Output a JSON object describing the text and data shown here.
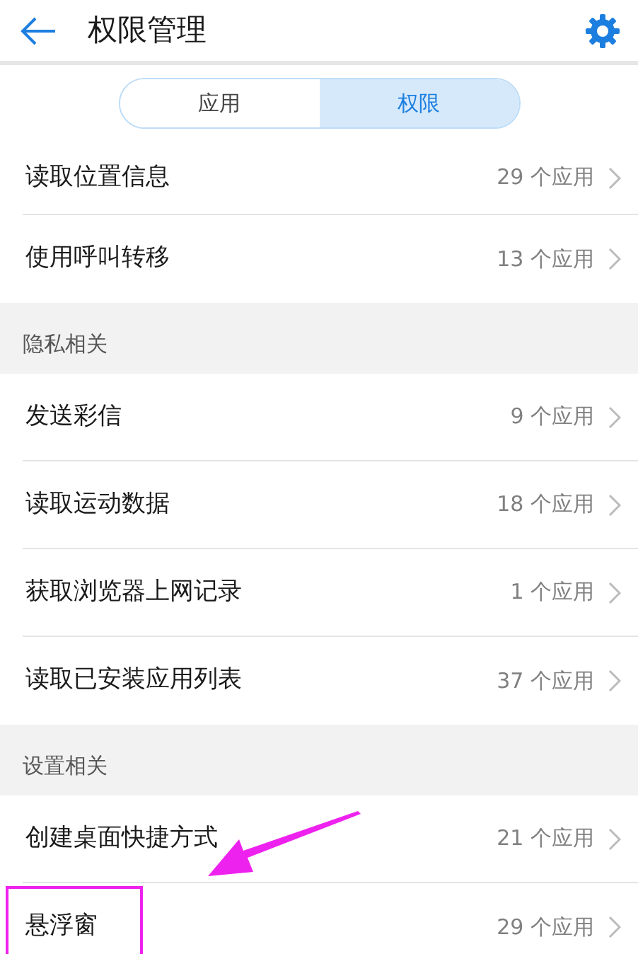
{
  "header": {
    "title": "权限管理"
  },
  "tabs": [
    {
      "label": "应用",
      "selected": false
    },
    {
      "label": "权限",
      "selected": true
    }
  ],
  "list": [
    {
      "kind": "row",
      "label": "读取位置信息",
      "count": "29 个应用",
      "highlighted": false
    },
    {
      "kind": "row",
      "label": "使用呼叫转移",
      "count": "13 个应用",
      "highlighted": false
    },
    {
      "kind": "section",
      "label": "隐私相关"
    },
    {
      "kind": "row",
      "label": "发送彩信",
      "count": "9 个应用",
      "highlighted": false
    },
    {
      "kind": "row",
      "label": "读取运动数据",
      "count": "18 个应用",
      "highlighted": false
    },
    {
      "kind": "row",
      "label": "获取浏览器上网记录",
      "count": "1 个应用",
      "highlighted": false
    },
    {
      "kind": "row",
      "label": "读取已安装应用列表",
      "count": "37 个应用",
      "highlighted": false
    },
    {
      "kind": "section",
      "label": "设置相关"
    },
    {
      "kind": "row",
      "label": "创建桌面快捷方式",
      "count": "21 个应用",
      "highlighted": false
    },
    {
      "kind": "row",
      "label": "悬浮窗",
      "count": "29 个应用",
      "highlighted": true
    }
  ]
}
